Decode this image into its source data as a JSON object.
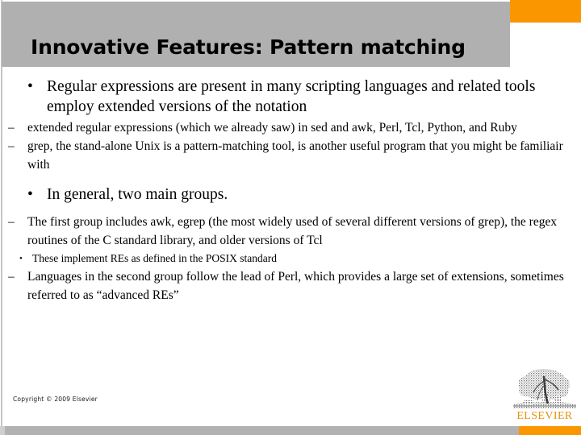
{
  "slide": {
    "title": "Innovative Features: Pattern matching",
    "theme": {
      "title_bar_color": "#b0b0b0",
      "accent_color": "#fa9600",
      "footer_bar_color": "#b2b2b2",
      "text_color": "#000000",
      "logo_color": "#e8920e"
    },
    "content": [
      {
        "level": 1,
        "bullet": "•",
        "text": "Regular expressions are present in many scripting languages and related tools employ extended versions of the notation"
      },
      {
        "level": 2,
        "bullet": "–",
        "text": "extended regular expressions (which we already saw) in sed and awk, Perl, Tcl, Python, and Ruby"
      },
      {
        "level": 2,
        "bullet": "–",
        "text": "grep, the stand-alone Unix is a pattern-matching tool, is another useful program that you might be familiair with"
      },
      {
        "level": 1,
        "bullet": "•",
        "text": "In general, two main groups."
      },
      {
        "level": 2,
        "bullet": "–",
        "text": "The first group includes awk, egrep (the most widely used of several different versions of grep), the regex routines of the C standard library, and older versions of Tcl"
      },
      {
        "level": 3,
        "bullet": "•",
        "text": "These implement REs as defined in the POSIX standard"
      },
      {
        "level": 2,
        "bullet": "–",
        "text": "Languages in the second group follow the lead of Perl, which provides a large set of extensions, sometimes referred to as “advanced REs”"
      }
    ],
    "footer": {
      "copyright": "Copyright © 2009 Elsevier",
      "logo_wordmark": "ELSEVIER",
      "logo_icon": "elsevier-tree-icon"
    }
  }
}
